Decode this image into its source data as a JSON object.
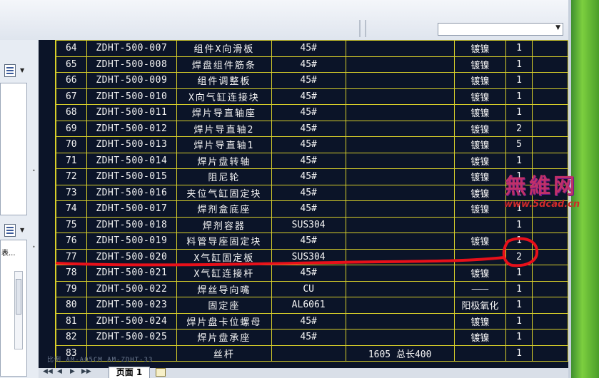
{
  "table": {
    "rows": [
      [
        "64",
        "ZDHT-500-007",
        "组件X向滑板",
        "45#",
        "",
        "镀镍",
        "1",
        ""
      ],
      [
        "65",
        "ZDHT-500-008",
        "焊盘组件筋条",
        "45#",
        "",
        "镀镍",
        "1",
        ""
      ],
      [
        "66",
        "ZDHT-500-009",
        "组件调整板",
        "45#",
        "",
        "镀镍",
        "1",
        ""
      ],
      [
        "67",
        "ZDHT-500-010",
        "X向气缸连接块",
        "45#",
        "",
        "镀镍",
        "1",
        ""
      ],
      [
        "68",
        "ZDHT-500-011",
        "焊片导直轴座",
        "45#",
        "",
        "镀镍",
        "1",
        ""
      ],
      [
        "69",
        "ZDHT-500-012",
        "焊片导直轴2",
        "45#",
        "",
        "镀镍",
        "2",
        ""
      ],
      [
        "70",
        "ZDHT-500-013",
        "焊片导直轴1",
        "45#",
        "",
        "镀镍",
        "5",
        ""
      ],
      [
        "71",
        "ZDHT-500-014",
        "焊片盘转轴",
        "45#",
        "",
        "镀镍",
        "1",
        ""
      ],
      [
        "72",
        "ZDHT-500-015",
        "阻尼轮",
        "45#",
        "",
        "镀镍",
        "1",
        ""
      ],
      [
        "73",
        "ZDHT-500-016",
        "夹位气缸固定块",
        "45#",
        "",
        "镀镍",
        "1",
        ""
      ],
      [
        "74",
        "ZDHT-500-017",
        "焊剂盒底座",
        "45#",
        "",
        "镀镍",
        "1",
        ""
      ],
      [
        "75",
        "ZDHT-500-018",
        "焊剂容器",
        "SUS304",
        "",
        "",
        "1",
        ""
      ],
      [
        "76",
        "ZDHT-500-019",
        "料管导座固定块",
        "45#",
        "",
        "镀镍",
        "1",
        ""
      ],
      [
        "77",
        "ZDHT-500-020",
        "X气缸固定板",
        "SUS304",
        "",
        "",
        "2",
        ""
      ],
      [
        "78",
        "ZDHT-500-021",
        "X气缸连接杆",
        "45#",
        "",
        "镀镍",
        "1",
        ""
      ],
      [
        "79",
        "ZDHT-500-022",
        "焊丝导向嘴",
        "CU",
        "",
        "———",
        "1",
        ""
      ],
      [
        "80",
        "ZDHT-500-023",
        "固定座",
        "AL6061",
        "",
        "阳极氧化",
        "1",
        ""
      ],
      [
        "81",
        "ZDHT-500-024",
        "焊片盘卡位螺母",
        "45#",
        "",
        "镀镍",
        "1",
        ""
      ],
      [
        "82",
        "ZDHT-500-025",
        "焊片盘承座",
        "45#",
        "",
        "镀镍",
        "1",
        ""
      ],
      [
        "83",
        "",
        "丝杆",
        "",
        "1605 总长400",
        "",
        "1",
        ""
      ]
    ]
  },
  "left_panel": {
    "pane2_text": "表..."
  },
  "watermark": {
    "logo_text": "無維网",
    "url": "www.5dcad.cn"
  },
  "faint_text": "比例  AM-A05CM  AM-ZDHT-33",
  "tabs": {
    "active": "页面 1"
  },
  "markup_color": "#e8101a",
  "accent_grid_color": "#d8cf2a"
}
